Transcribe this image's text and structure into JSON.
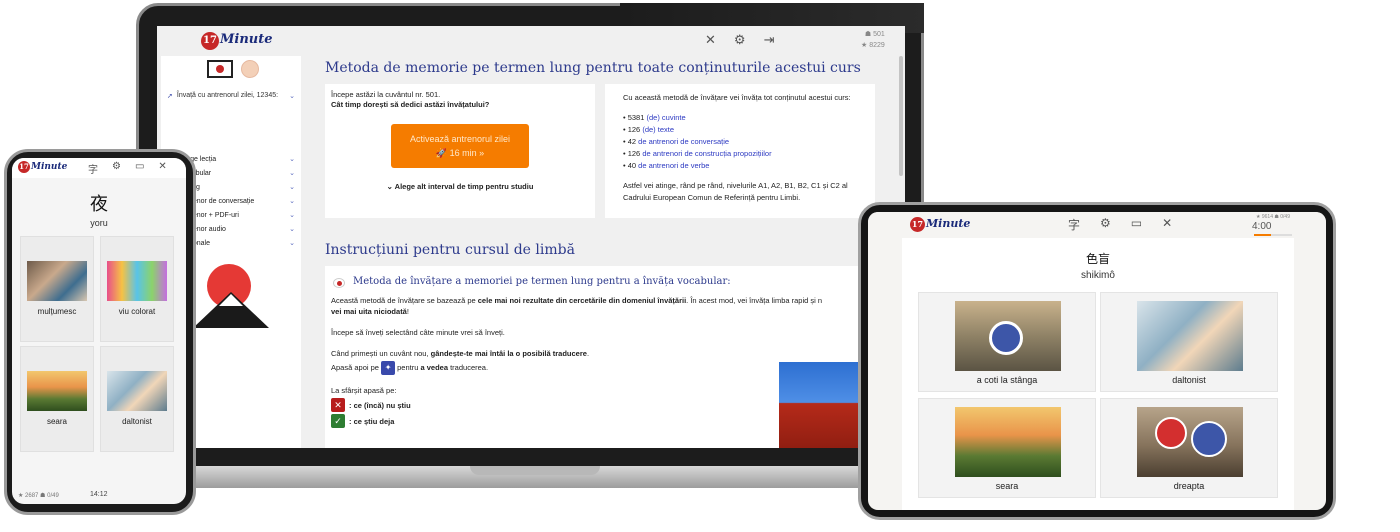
{
  "brand": {
    "logo_number": "17",
    "logo_text": "Minute"
  },
  "laptop": {
    "toolbar": {
      "stat1": "☗ 501",
      "stat2": "★ 8229"
    },
    "sidebar": {
      "trainer_label": "Învață cu antrenorul zilei, 12345:",
      "items": [
        {
          "label": "Alege lecția"
        },
        {
          "label": "Vocabular"
        },
        {
          "label": "Dialog"
        },
        {
          "label": "Antrenor de conversație"
        },
        {
          "label": "Antrenor + PDF-uri"
        },
        {
          "label": "Antrenor audio"
        },
        {
          "label": "Opționale"
        }
      ]
    },
    "heading1": "Metoda de memorie pe termen lung pentru toate conținuturile acestui curs",
    "card_start": {
      "line1": "Începe astăzi la cuvântul nr. 501.",
      "question": "Cât timp dorești să dedici astăzi învățatului?",
      "cta_line1": "Activează antrenorul zilei",
      "cta_line2": "🚀 16 min  »",
      "alt_interval": "⌄ Alege alt interval de timp pentru studiu"
    },
    "card_content": {
      "intro": "Cu această metodă de învățare vei învăța tot conținutul acestui curs:",
      "items": [
        {
          "count": "• 5381",
          "link": "(de) cuvinte"
        },
        {
          "count": "• 126",
          "link": "(de) texte"
        },
        {
          "count": "• 42",
          "link": "de antrenori de conversație"
        },
        {
          "count": "• 126",
          "link": "de antrenori de construcția propozițiilor"
        },
        {
          "count": "• 40",
          "link": "de antrenori de verbe"
        }
      ],
      "after": "Astfel vei atinge, rând pe rând, nivelurile A1, A2, B1, B2, C1 și C2 al Cadrului European Comun de Referință pentru Limbi."
    },
    "heading2": "Instrucțiuni pentru cursul de limbă",
    "instructions": {
      "subtitle": "Metoda de învățare a memoriei pe termen lung pentru a învăța vocabular:",
      "p1_a": "Această metodă de învățare se bazează pe ",
      "p1_b": "cele mai noi rezultate din cercetările din domeniul învățării",
      "p1_c": ". În acest mod, vei învăța limba rapid și n",
      "p1_d": "vei mai uita niciodată",
      "p1_e": "!",
      "p2": "Începe să înveți selectând câte minute vrei să înveți.",
      "p3_a": "Când primești un cuvânt nou, ",
      "p3_b": "gândește-te mai întâi la o posibilă traducere",
      "p3_c": ".",
      "p4_a": "Apasă apoi pe ",
      "p4_b": " pentru ",
      "p4_c": "a vedea",
      "p4_d": " traducerea.",
      "p5": "La sfârșit apasă pe:",
      "unknown": ": ce (încă) nu știu",
      "known": ": ce știu deja"
    }
  },
  "phone": {
    "word": "夜",
    "reading": "yoru",
    "tiles": [
      {
        "label": "mulțumesc"
      },
      {
        "label": "viu colorat"
      },
      {
        "label": "seara"
      },
      {
        "label": "daltonist"
      }
    ],
    "footer_stats": "★ 2687  ☗ 0/49",
    "footer_time": "14:12"
  },
  "tablet": {
    "stats": "★ 9614 ☗ 0/49",
    "timer": "4:00",
    "timer_progress": 0.45,
    "word": "色盲",
    "reading": "shikimô",
    "tiles": [
      {
        "label": "a coti la stânga"
      },
      {
        "label": "daltonist"
      },
      {
        "label": "seara"
      },
      {
        "label": "dreapta"
      }
    ]
  },
  "icons": {
    "kanji_toggle": "kanji-toggle-icon",
    "settings": "gear-icon",
    "logout": "logout-icon",
    "keyboard": "keyboard-icon",
    "mute": "mute-icon"
  }
}
